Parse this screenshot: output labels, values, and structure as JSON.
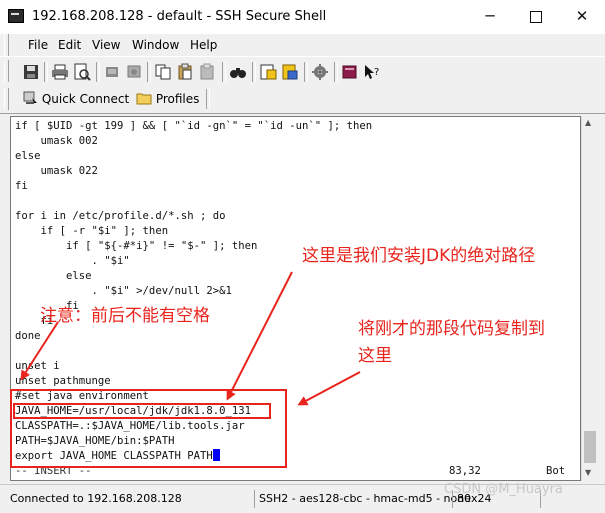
{
  "window": {
    "title": "192.168.208.128 - default - SSH Secure Shell",
    "minimize_glyph": "─",
    "close_glyph": "✕"
  },
  "menu": {
    "file": "File",
    "edit": "Edit",
    "view": "View",
    "window": "Window",
    "help": "Help"
  },
  "toolbar2": {
    "quick_connect": "Quick Connect",
    "profiles": "Profiles"
  },
  "terminal": {
    "lines": [
      "if [ $UID -gt 199 ] && [ \"`id -gn`\" = \"`id -un`\" ]; then",
      "    umask 002",
      "else",
      "    umask 022",
      "fi",
      "",
      "for i in /etc/profile.d/*.sh ; do",
      "    if [ -r \"$i\" ]; then",
      "        if [ \"${-#*i}\" != \"$-\" ]; then",
      "            . \"$i\"",
      "        else",
      "            . \"$i\" >/dev/null 2>&1",
      "        fi",
      "    fi",
      "done",
      "",
      "unset i",
      "unset pathmunge",
      "#set java environment",
      "JAVA_HOME=/usr/local/jdk/jdk1.8.0_131",
      "CLASSPATH=.:$JAVA_HOME/lib.tools.jar",
      "PATH=$JAVA_HOME/bin:$PATH",
      "export JAVA_HOME CLASSPATH PATH"
    ],
    "mode": "-- INSERT --",
    "position": "83,32",
    "scroll": "Bot"
  },
  "annotations": {
    "jdk_path_note": "这里是我们安装JDK的绝对路径",
    "spaces_note": "注意：前后不能有空格",
    "copy_note_line1": "将刚才的那段代码复制到",
    "copy_note_line2": "这里"
  },
  "status": {
    "connection": "Connected to 192.168.208.128",
    "cipher": "SSH2 - aes128-cbc - hmac-md5 - none",
    "size": "80x24"
  },
  "watermark": "CSDN @M_Huayra",
  "colors": {
    "annotation": "#e8241c",
    "cursor": "#0000ff"
  }
}
